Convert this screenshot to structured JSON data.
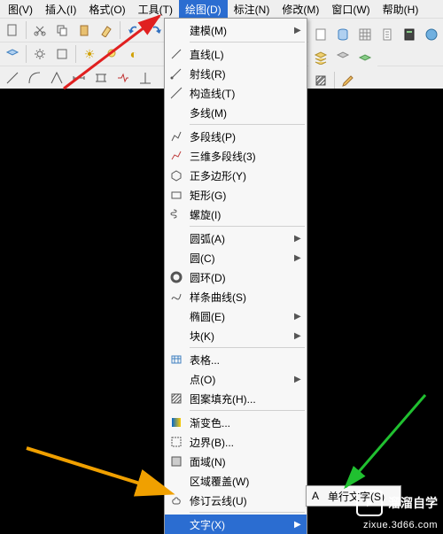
{
  "menubar": {
    "items": [
      {
        "label": "图(V)"
      },
      {
        "label": "插入(I)"
      },
      {
        "label": "格式(O)"
      },
      {
        "label": "工具(T)"
      },
      {
        "label": "绘图(D)",
        "open": true
      },
      {
        "label": "标注(N)"
      },
      {
        "label": "修改(M)"
      },
      {
        "label": "窗口(W)"
      },
      {
        "label": "帮助(H)"
      }
    ]
  },
  "dropdown": {
    "items": [
      {
        "icon": "cube",
        "label": "建模(M)",
        "sub": true
      },
      {
        "sep": true
      },
      {
        "icon": "line",
        "label": "直线(L)"
      },
      {
        "icon": "ray",
        "label": "射线(R)"
      },
      {
        "icon": "xline",
        "label": "构造线(T)"
      },
      {
        "icon": "mline",
        "label": "多线(M)"
      },
      {
        "sep": true
      },
      {
        "icon": "pline",
        "label": "多段线(P)"
      },
      {
        "icon": "p3d",
        "label": "三维多段线(3)"
      },
      {
        "icon": "poly",
        "label": "正多边形(Y)"
      },
      {
        "icon": "rect",
        "label": "矩形(G)"
      },
      {
        "icon": "helix",
        "label": "螺旋(I)"
      },
      {
        "sep": true
      },
      {
        "icon": "arc",
        "label": "圆弧(A)",
        "sub": true
      },
      {
        "icon": "circle",
        "label": "圆(C)",
        "sub": true
      },
      {
        "icon": "donut",
        "label": "圆环(D)"
      },
      {
        "icon": "spline",
        "label": "样条曲线(S)"
      },
      {
        "icon": "ellipse",
        "label": "椭圆(E)",
        "sub": true
      },
      {
        "icon": "block",
        "label": "块(K)",
        "sub": true
      },
      {
        "sep": true
      },
      {
        "icon": "table",
        "label": "表格..."
      },
      {
        "icon": "point",
        "label": "点(O)",
        "sub": true
      },
      {
        "icon": "hatch",
        "label": "图案填充(H)..."
      },
      {
        "sep": true
      },
      {
        "icon": "grad",
        "label": "渐变色..."
      },
      {
        "icon": "bound",
        "label": "边界(B)..."
      },
      {
        "icon": "region",
        "label": "面域(N)"
      },
      {
        "icon": "wipe",
        "label": "区域覆盖(W)"
      },
      {
        "icon": "revcloud",
        "label": "修订云线(U)"
      },
      {
        "sep": true
      },
      {
        "icon": "text",
        "label": "文字(X)",
        "sub": true,
        "selected": true
      }
    ]
  },
  "subfly": {
    "label": "单行文字(S)"
  },
  "watermark": {
    "brand": "溜溜自学",
    "url": "zixue.3d66.com"
  }
}
